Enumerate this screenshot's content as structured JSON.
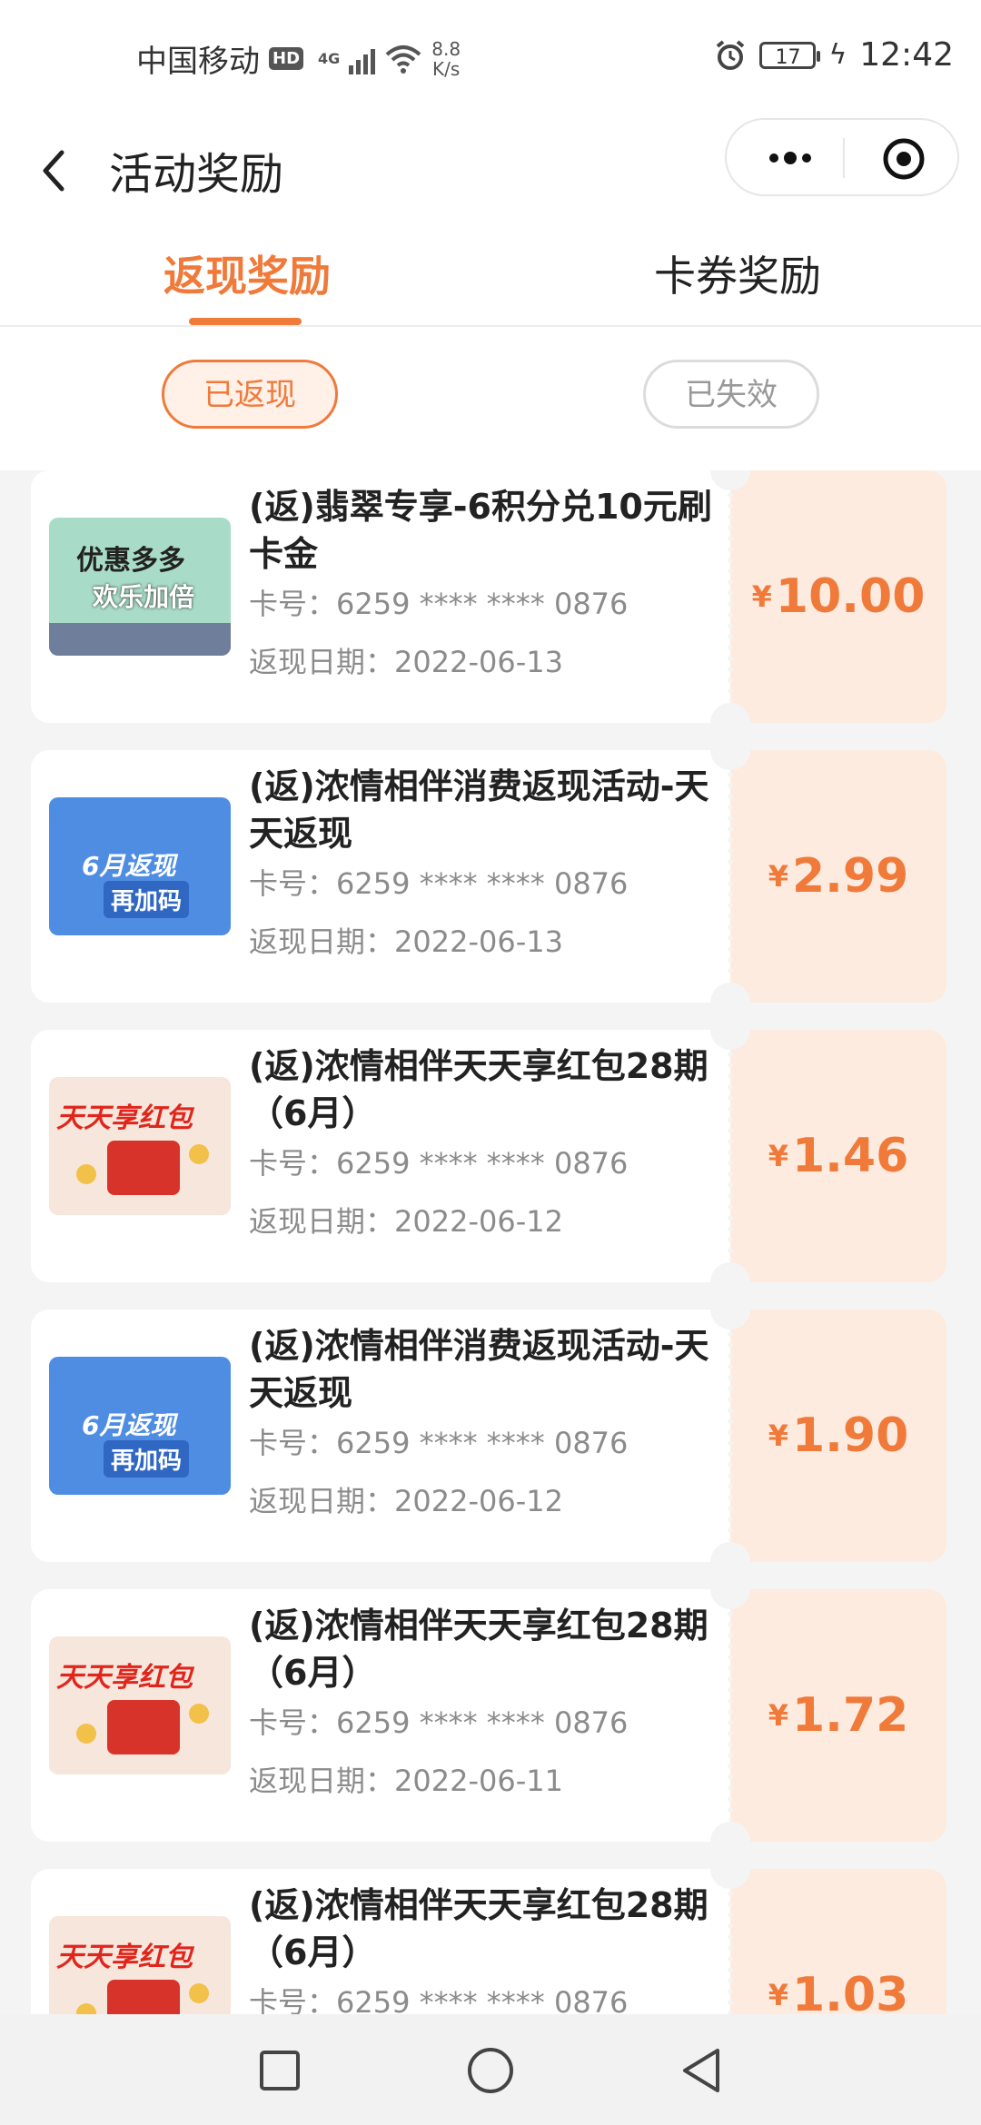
{
  "status_bar": {
    "carrier": "中国移动",
    "hd": "HD",
    "network": "4G",
    "speed_value": "8.8",
    "speed_unit": "K/s",
    "battery": "17",
    "time": "12:42"
  },
  "header": {
    "title": "活动奖励"
  },
  "tabs": [
    {
      "label": "返现奖励",
      "active": true
    },
    {
      "label": "卡券奖励",
      "active": false
    }
  ],
  "filters": [
    {
      "label": "已返现",
      "selected": true
    },
    {
      "label": "已失效",
      "selected": false
    }
  ],
  "rewards": [
    {
      "title": "(返)翡翠专享-6积分兑10元刷卡金",
      "card_no": "卡号：6259 **** **** 0876",
      "date": "返现日期：2022-06-13",
      "currency": "¥",
      "amount": "10.00",
      "thumb_text": [
        "优惠多多",
        "欢乐加倍"
      ]
    },
    {
      "title": "(返)浓情相伴消费返现活动-天天返现",
      "card_no": "卡号：6259 **** **** 0876",
      "date": "返现日期：2022-06-13",
      "currency": "¥",
      "amount": "2.99",
      "thumb_text": [
        "6月返现",
        "再加码"
      ]
    },
    {
      "title": "(返)浓情相伴天天享红包28期（6月）",
      "card_no": "卡号：6259 **** **** 0876",
      "date": "返现日期：2022-06-12",
      "currency": "¥",
      "amount": "1.46",
      "thumb_text": [
        "天天享红包"
      ]
    },
    {
      "title": "(返)浓情相伴消费返现活动-天天返现",
      "card_no": "卡号：6259 **** **** 0876",
      "date": "返现日期：2022-06-12",
      "currency": "¥",
      "amount": "1.90",
      "thumb_text": [
        "6月返现",
        "再加码"
      ]
    },
    {
      "title": "(返)浓情相伴天天享红包28期（6月）",
      "card_no": "卡号：6259 **** **** 0876",
      "date": "返现日期：2022-06-11",
      "currency": "¥",
      "amount": "1.72",
      "thumb_text": [
        "天天享红包"
      ]
    },
    {
      "title": "(返)浓情相伴天天享红包28期（6月）",
      "card_no": "卡号：6259 **** **** 0876",
      "date": "",
      "currency": "¥",
      "amount": "1.03",
      "thumb_text": [
        "天天享红包"
      ]
    }
  ],
  "colors": {
    "accent": "#f07a3a",
    "amount_bg": "#fdebe0",
    "page_bg": "#f4f4f4"
  },
  "icons": {
    "back": "back-arrow-icon",
    "more": "more-dots-icon",
    "close": "target-close-icon",
    "nav": [
      "square-icon",
      "circle-icon",
      "triangle-back-icon"
    ]
  }
}
